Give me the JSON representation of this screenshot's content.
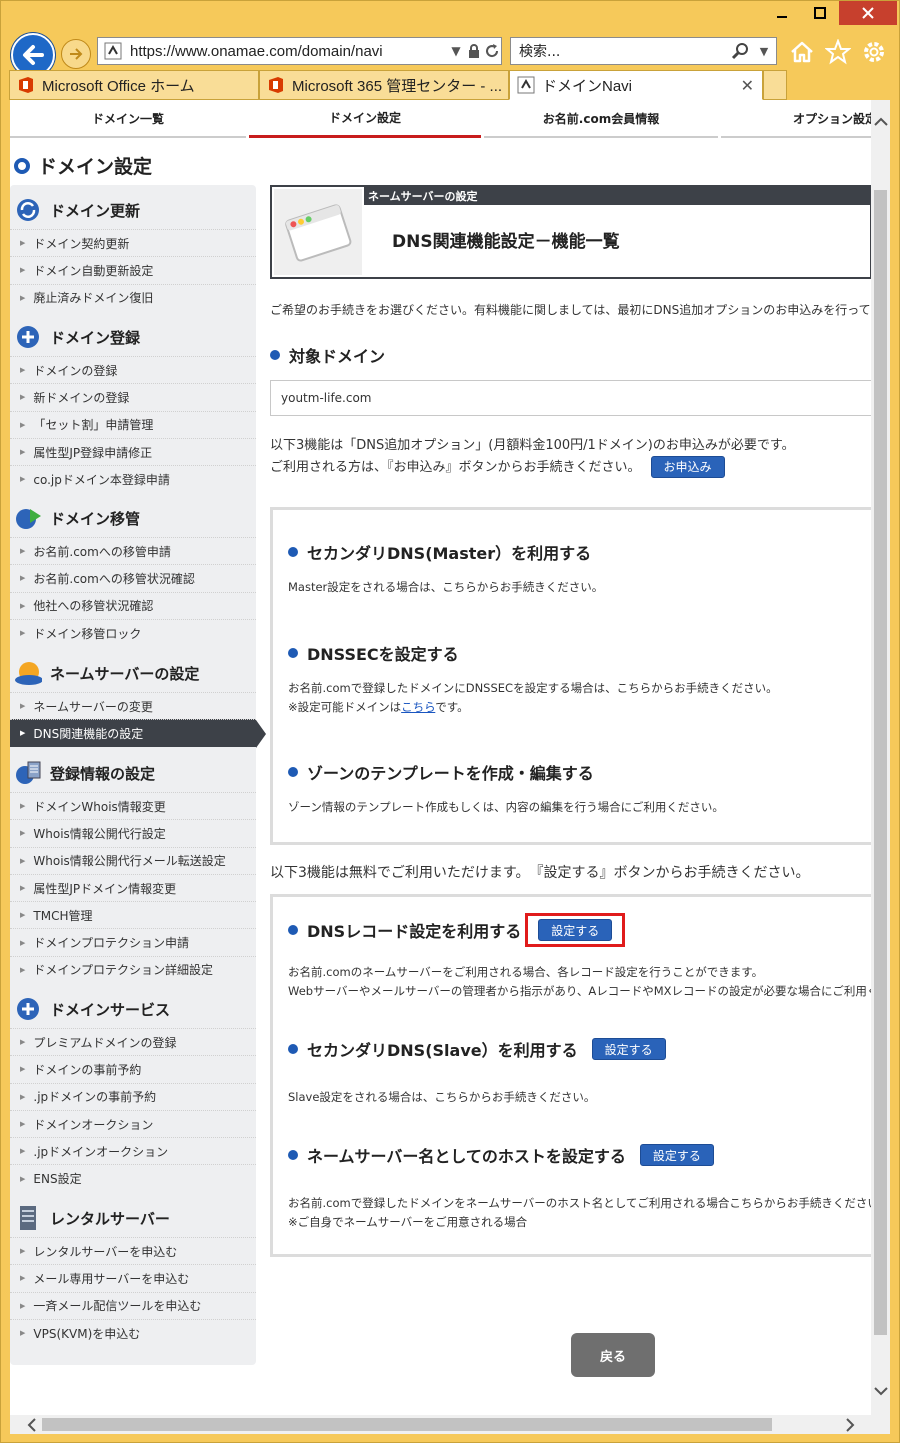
{
  "browser": {
    "address": "https://www.onamae.com/domain/navi",
    "search_placeholder": "検索...",
    "tabs": [
      {
        "label": "Microsoft Office ホーム"
      },
      {
        "label": "Microsoft 365 管理センター - ..."
      },
      {
        "label": "ドメインNavi"
      }
    ]
  },
  "topnav": {
    "items": [
      "ドメイン一覧",
      "ドメイン設定",
      "お名前.com会員情報",
      "オプション設定"
    ]
  },
  "page": {
    "title": "ドメイン設定"
  },
  "sidebar": {
    "sections": [
      {
        "title": "ドメイン更新",
        "items": [
          "ドメイン契約更新",
          "ドメイン自動更新設定",
          "廃止済みドメイン復旧"
        ]
      },
      {
        "title": "ドメイン登録",
        "items": [
          "ドメインの登録",
          "新ドメインの登録",
          "「セット割」申請管理",
          "属性型JP登録申請修正",
          "co.jpドメイン本登録申請"
        ]
      },
      {
        "title": "ドメイン移管",
        "items": [
          "お名前.comへの移管申請",
          "お名前.comへの移管状況確認",
          "他社への移管状況確認",
          "ドメイン移管ロック"
        ]
      },
      {
        "title": "ネームサーバーの設定",
        "items": [
          "ネームサーバーの変更",
          "DNS関連機能の設定"
        ]
      },
      {
        "title": "登録情報の設定",
        "items": [
          "ドメインWhois情報変更",
          "Whois情報公開代行設定",
          "Whois情報公開代行メール転送設定",
          "属性型JPドメイン情報変更",
          "TMCH管理",
          "ドメインプロテクション申請",
          "ドメインプロテクション詳細設定"
        ]
      },
      {
        "title": "ドメインサービス",
        "items": [
          "プレミアムドメインの登録",
          "ドメインの事前予約",
          ".jpドメインの事前予約",
          "ドメインオークション",
          ".jpドメインオークション",
          "ENS設定"
        ]
      },
      {
        "title": "レンタルサーバー",
        "items": [
          "レンタルサーバーを申込む",
          "メール専用サーバーを申込む",
          "一斉メール配信ツールを申込む",
          "VPS(KVM)を申込む"
        ]
      }
    ]
  },
  "main": {
    "header_strip": "ネームサーバーの設定",
    "header_title": "DNS関連機能設定－機能一覧",
    "intro": "ご希望のお手続きをお選びください。有料機能に関しましては、最初にDNS追加オプションのお申込みを行ってください。",
    "target_heading": "対象ドメイン",
    "domain_value": "youtm-life.com",
    "paid_note_1": "以下3機能は「DNS追加オプション」(月額料金100円/1ドメイン)のお申込みが必要です。",
    "paid_note_2": "ご利用される方は、『お申込み』ボタンからお手続きください。",
    "apply_button": "お申込み",
    "paid_features": [
      {
        "title": "セカンダリDNS(Master）を利用する",
        "desc": [
          "Master設定をされる場合は、こちらからお手続きください。"
        ]
      },
      {
        "title": "DNSSECを設定する",
        "desc": [
          "お名前.comで登録したドメインにDNSSECを設定する場合は、こちらからお手続きください。"
        ],
        "desc2_pre": "※設定可能ドメインは",
        "desc2_link": "こちら",
        "desc2_post": "です。"
      },
      {
        "title": "ゾーンのテンプレートを作成・編集する",
        "desc": [
          "ゾーン情報のテンプレート作成もしくは、内容の編集を行う場合にご利用ください。"
        ]
      }
    ],
    "free_note": "以下3機能は無料でご利用いただけます。　『設定する』ボタンからお手続きください。",
    "free_features": [
      {
        "title": "DNSレコード設定を利用する",
        "button": "設定する",
        "desc": [
          "お名前.comのネームサーバーをご利用される場合、各レコード設定を行うことができます。",
          "Webサーバーやメールサーバーの管理者から指示があり、AレコードやMXレコードの設定が必要な場合にご利用ください。"
        ]
      },
      {
        "title": "セカンダリDNS(Slave）を利用する",
        "button": "設定する",
        "desc": [
          "Slave設定をされる場合は、こちらからお手続きください。"
        ]
      },
      {
        "title": "ネームサーバー名としてのホストを設定する",
        "button": "設定する",
        "desc": [
          "お名前.comで登録したドメインをネームサーバーのホスト名としてご利用される場合こちらからお手続きください。",
          "※ご自身でネームサーバーをご用意される場合"
        ]
      }
    ],
    "back_button": "戻る"
  }
}
